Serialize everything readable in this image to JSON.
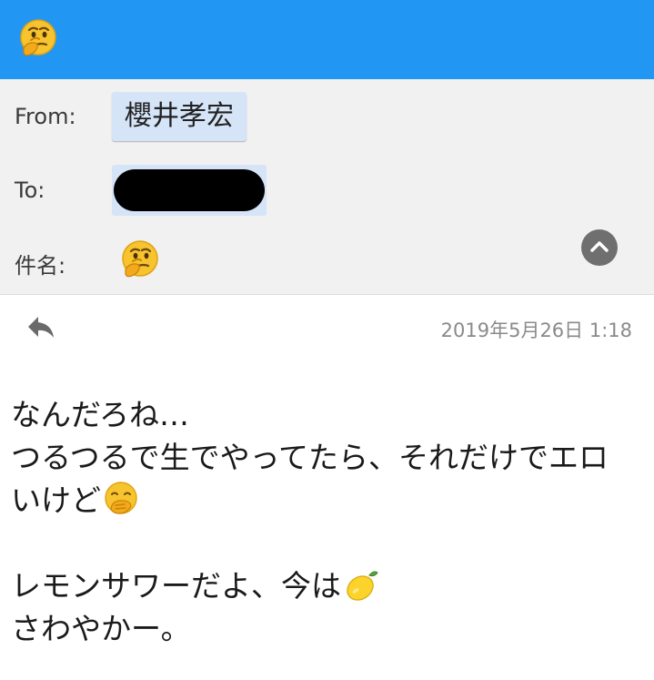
{
  "topbar": {
    "icon": "thinking-face-icon",
    "color": "#2196f3"
  },
  "header": {
    "from_label": "From:",
    "from_value": "櫻井孝宏",
    "to_label": "To:",
    "to_value_redacted": true,
    "subject_label": "件名:",
    "subject_icon": "thinking-face-icon"
  },
  "message": {
    "date": "2019年5月26日 1:18",
    "lines": [
      "なんだろね…",
      "つるつるで生でやってたら、それだけでエロ",
      "いけど",
      "",
      "レモンサワーだよ、今は",
      "さわやかー。"
    ],
    "line3_icon": "hand-over-mouth-icon",
    "line5_icon": "lemon-icon"
  }
}
